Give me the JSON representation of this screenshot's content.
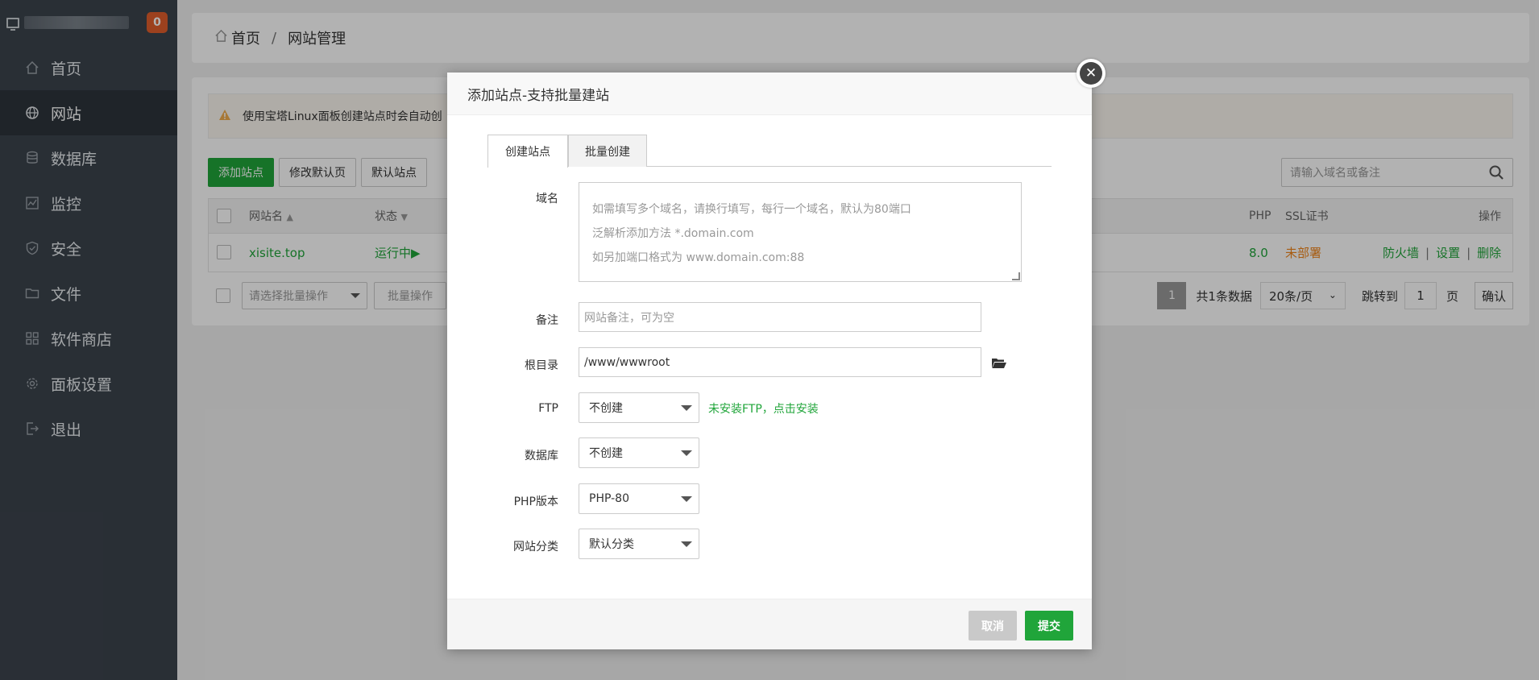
{
  "sidebar": {
    "badge": "0",
    "items": [
      {
        "label": "首页",
        "icon": "home-icon"
      },
      {
        "label": "网站",
        "icon": "globe-icon"
      },
      {
        "label": "数据库",
        "icon": "database-icon"
      },
      {
        "label": "监控",
        "icon": "monitor-icon"
      },
      {
        "label": "安全",
        "icon": "shield-icon"
      },
      {
        "label": "文件",
        "icon": "folder-icon"
      },
      {
        "label": "软件商店",
        "icon": "grid-icon"
      },
      {
        "label": "面板设置",
        "icon": "gear-icon"
      },
      {
        "label": "退出",
        "icon": "logout-icon"
      }
    ],
    "active_index": 1
  },
  "breadcrumb": {
    "home": "首页",
    "separator": "/",
    "current": "网站管理"
  },
  "notice": {
    "text": "使用宝塔Linux面板创建站点时会自动创"
  },
  "toolbar": {
    "add_site": "添加站点",
    "modify_default_page": "修改默认页",
    "default_site": "默认站点"
  },
  "search": {
    "placeholder": "请输入域名或备注"
  },
  "table": {
    "headers": {
      "name": "网站名",
      "status": "状态",
      "php": "PHP",
      "ssl": "SSL证书",
      "actions": "操作"
    },
    "rows": [
      {
        "name": "xisite.top",
        "status": "运行中",
        "php": "8.0",
        "ssl": "未部署",
        "action_firewall": "防火墙",
        "action_settings": "设置",
        "action_delete": "删除"
      }
    ]
  },
  "bottom": {
    "batch_select": "请选择批量操作",
    "batch_button": "批量操作",
    "current_page": "1",
    "total": "共1条数据",
    "per_page": "20条/页",
    "jump_label": "跳转到",
    "jump_value": "1",
    "page_unit": "页",
    "confirm": "确认"
  },
  "modal": {
    "title": "添加站点-支持批量建站",
    "tabs": [
      "创建站点",
      "批量创建"
    ],
    "domain_label": "域名",
    "domain_placeholder_lines": [
      "如需填写多个域名，请换行填写，每行一个域名，默认为80端口",
      "泛解析添加方法 *.domain.com",
      "如另加端口格式为 www.domain.com:88"
    ],
    "remark_label": "备注",
    "remark_placeholder": "网站备注，可为空",
    "root_label": "根目录",
    "root_value": "/www/wwwroot",
    "ftp_label": "FTP",
    "ftp_value": "不创建",
    "ftp_hint": "未安装FTP，点击安装",
    "db_label": "数据库",
    "db_value": "不创建",
    "php_label": "PHP版本",
    "php_value": "PHP-80",
    "category_label": "网站分类",
    "category_value": "默认分类",
    "cancel": "取消",
    "submit": "提交"
  },
  "colors": {
    "accent_green": "#20a53a",
    "sidebar_bg": "#3c444d",
    "badge_orange": "#e05d2b",
    "ssl_orange": "#f0851a"
  }
}
